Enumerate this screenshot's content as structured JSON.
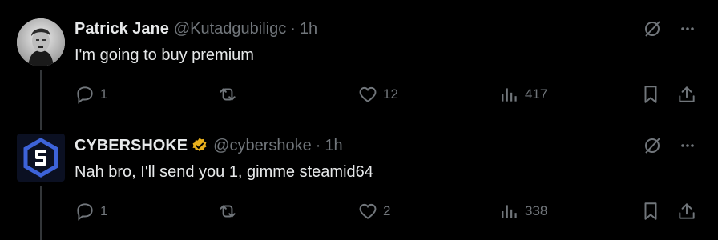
{
  "tweets": [
    {
      "display_name": "Patrick Jane",
      "handle": "@Kutadgubiligc",
      "separator": "·",
      "time": "1h",
      "text": "I'm going to buy premium",
      "replies": "1",
      "reposts": "",
      "likes": "12",
      "views": "417",
      "verified": false
    },
    {
      "display_name": "CYBERSHOKE",
      "handle": "@cybershoke",
      "separator": "·",
      "time": "1h",
      "text": "Nah bro, I'll send you 1, gimme steamid64",
      "replies": "1",
      "reposts": "",
      "likes": "2",
      "views": "338",
      "verified": true
    }
  ],
  "colors": {
    "background": "#000000",
    "text_primary": "#e7e9ea",
    "text_secondary": "#71767b",
    "thread_line": "#333639",
    "verified_gold": "#e8b01d",
    "cybershoke_blue": "#3d63d9"
  },
  "icons": [
    "grok-icon",
    "more-icon",
    "reply-icon",
    "repost-icon",
    "like-icon",
    "views-icon",
    "bookmark-icon",
    "share-icon",
    "verified-badge-icon"
  ]
}
